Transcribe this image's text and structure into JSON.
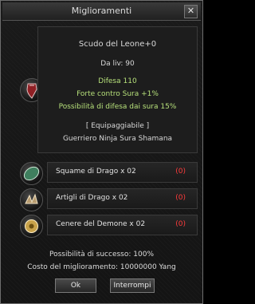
{
  "window": {
    "title": "Miglioramenti",
    "close_glyph": "✕"
  },
  "item": {
    "name": "Scudo del Leone+0",
    "level": "Da liv: 90",
    "defense": "Difesa 110",
    "bonus_1": "Forte contro Sura +1%",
    "bonus_2": "Possibilità di difesa dai sura 15%",
    "equippable": "[ Equipaggiabile ]",
    "classes": "Guerriero Ninja Sura Shamana",
    "icon": "lion-shield-icon"
  },
  "materials": [
    {
      "name": "Squame di Drago x 02",
      "count": "(0)",
      "icon": "dragon-scale-icon"
    },
    {
      "name": "Artigli di Drago x 02",
      "count": "(0)",
      "icon": "dragon-claw-icon"
    },
    {
      "name": "Cenere del Demone x 02",
      "count": "(0)",
      "icon": "demon-ash-icon"
    }
  ],
  "footer": {
    "success": "Possibilità di successo: 100%",
    "cost": "Costo del miglioramento: 10000000 Yang"
  },
  "buttons": {
    "ok": "Ok",
    "cancel": "Interrompi"
  },
  "colors": {
    "bonus_green": "#b6e07a",
    "count_red": "#ff3b3b"
  }
}
